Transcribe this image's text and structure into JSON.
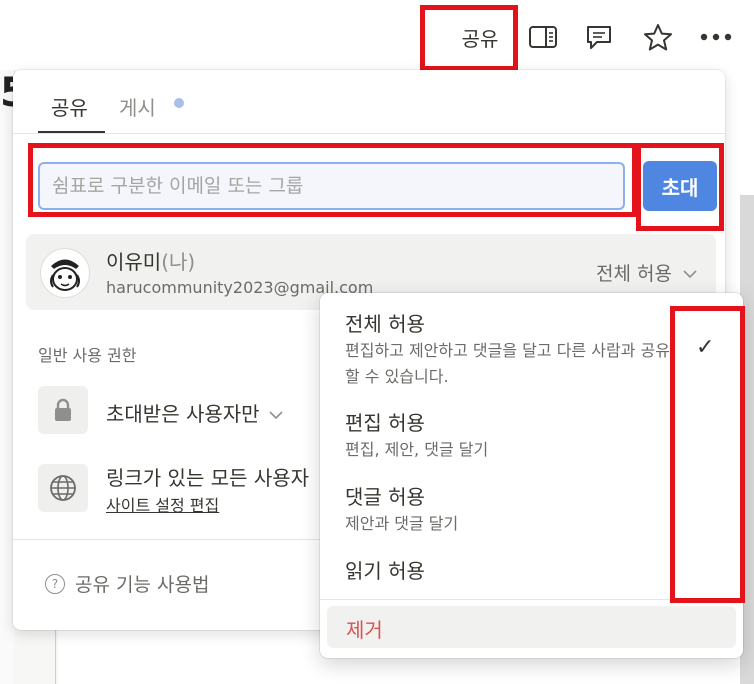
{
  "toolbar": {
    "share_label": "공유",
    "icons": [
      "sidebar-panel-icon",
      "comment-icon",
      "star-icon",
      "more-icon"
    ]
  },
  "background": {
    "title_fragment": "5"
  },
  "share_panel": {
    "tabs": [
      {
        "label": "공유",
        "active": true
      },
      {
        "label": "게시",
        "active": false
      }
    ],
    "email_input": {
      "placeholder": "쉼표로 구분한 이메일 또는 그룹",
      "value": ""
    },
    "invite_label": "초대",
    "user": {
      "name": "이유미",
      "me_suffix": "(나)",
      "email": "harucommunity2023@gmail.com",
      "permission": "전체 허용"
    },
    "general_access": {
      "section_label": "일반 사용 권한",
      "invited_only": "초대받은 사용자만",
      "link_users": "링크가 있는 모든 사용자",
      "site_settings_link": "사이트 설정 편집"
    },
    "help_label": "공유 기능 사용법"
  },
  "permission_menu": {
    "options": [
      {
        "title": "전체 허용",
        "desc": "편집하고 제안하고 댓글을 달고 다른 사람과 공유할 수 있습니다.",
        "checked": true
      },
      {
        "title": "편집 허용",
        "desc": "편집, 제안, 댓글 달기",
        "checked": false
      },
      {
        "title": "댓글 허용",
        "desc": "제안과 댓글 달기",
        "checked": false
      },
      {
        "title": "읽기 허용",
        "desc": "",
        "checked": false
      }
    ],
    "remove_label": "제거"
  },
  "colors": {
    "accent": "#4f86e2",
    "highlight_box": "#e3121b",
    "remove_text": "#d9534f"
  }
}
